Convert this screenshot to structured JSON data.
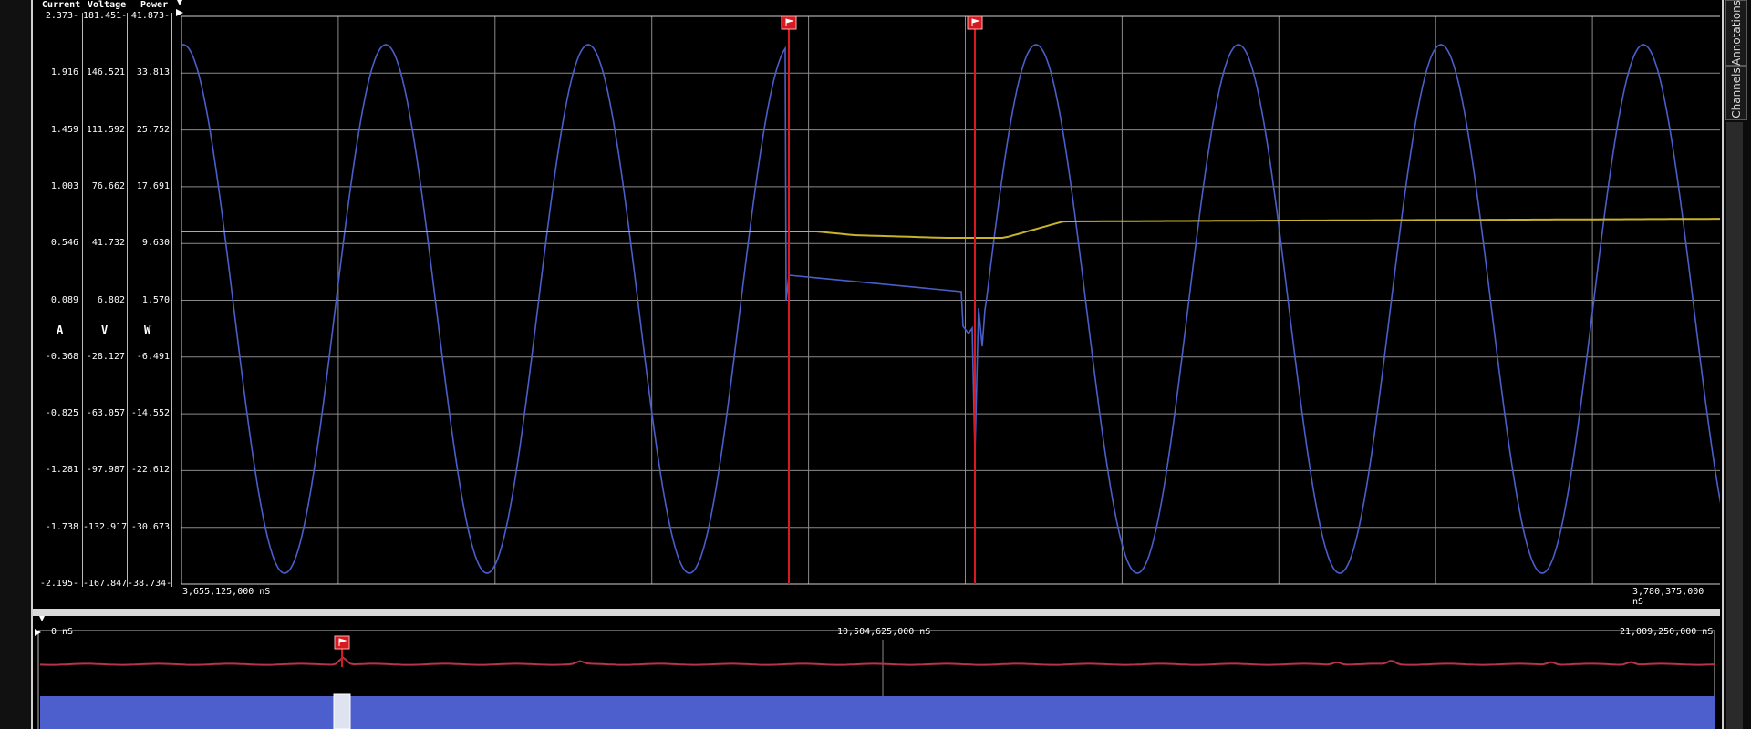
{
  "main_chart": {
    "headers": {
      "current": "Current",
      "voltage": "Voltage",
      "power": "Power"
    },
    "units": {
      "current": "A",
      "voltage": "V",
      "power": "W"
    },
    "ticks": [
      {
        "current": "2.373",
        "voltage": "181.451",
        "power": "41.873"
      },
      {
        "current": "1.916",
        "voltage": "146.521",
        "power": "33.813"
      },
      {
        "current": "1.459",
        "voltage": "111.592",
        "power": "25.752"
      },
      {
        "current": "1.003",
        "voltage": "76.662",
        "power": "17.691"
      },
      {
        "current": "0.546",
        "voltage": "41.732",
        "power": "9.630"
      },
      {
        "current": "0.089",
        "voltage": "6.802",
        "power": "1.570"
      },
      {
        "current": "-0.368",
        "voltage": "-28.127",
        "power": "-6.491"
      },
      {
        "current": "-0.825",
        "voltage": "-63.057",
        "power": "-14.552"
      },
      {
        "current": "-1.281",
        "voltage": "-97.987",
        "power": "-22.612"
      },
      {
        "current": "-1.738",
        "voltage": "-132.917",
        "power": "-30.673"
      },
      {
        "current": "-2.195",
        "voltage": "-167.847",
        "power": "-38.734"
      }
    ],
    "x_start": "3,655,125,000 nS",
    "x_end": "3,780,375,000 nS",
    "marker_icon": "flag-marker-icon",
    "colors": {
      "voltage_trace": "#4a5ec9",
      "current_trace": "#c8b428",
      "marker": "#d8191f",
      "grid": "#8a8a8a"
    }
  },
  "overview": {
    "x_start": "0 nS",
    "x_mid": "10,504,625,000 nS",
    "x_end": "21,009,250,000 nS",
    "colors": {
      "power_trace": "#b8334a",
      "voltage_band": "#4c5fcc"
    }
  },
  "side_tabs": {
    "annotations": "Annotations",
    "channels": "Channels"
  }
}
